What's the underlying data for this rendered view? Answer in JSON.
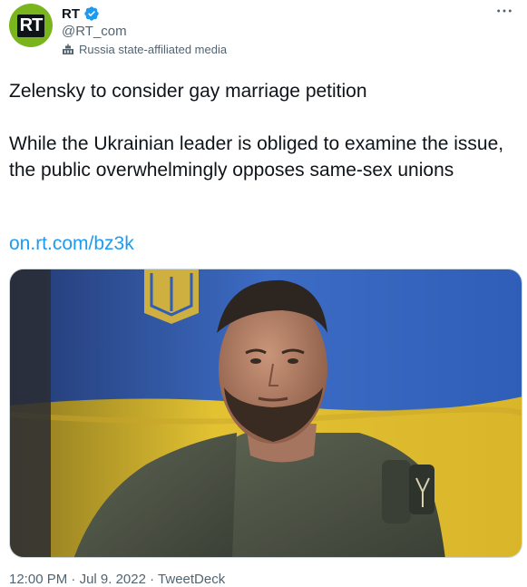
{
  "author": {
    "avatar_text": "RT",
    "display_name": "RT",
    "handle": "@RT_com",
    "label": "Russia state-affiliated media"
  },
  "tweet": {
    "headline": "Zelensky to consider gay marriage petition",
    "body": "While the Ukrainian leader is obliged to examine the issue, the public overwhelmingly opposes same-sex unions",
    "link": "on.rt.com/bz3k"
  },
  "meta": {
    "time": "12:00 PM",
    "sep1": "·",
    "date": "Jul 9. 2022",
    "sep2": "·",
    "source": "TweetDeck"
  },
  "icons": {
    "verified": "verified-badge-icon",
    "label": "state-media-flag-icon",
    "more": "more-options-icon"
  },
  "colors": {
    "link": "#1d9bf0",
    "verified": "#1d9bf0",
    "avatar": "#7ab51d",
    "secondary_text": "#536471"
  }
}
